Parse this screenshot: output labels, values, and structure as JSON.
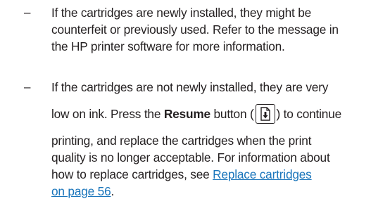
{
  "list": {
    "bullet_symbol": "–",
    "item1": {
      "line1": "If the cartridges are newly installed, they might be",
      "line2": "counterfeit or previously used. Refer to the message in",
      "line3": "the HP printer software for more information."
    },
    "item2": {
      "line1": "If the cartridges are not newly installed, they are very",
      "line2_before": "low on ink. Press the ",
      "line2_bold": "Resume",
      "line2_mid": " button (",
      "line2_after": ") to continue",
      "line3": "printing, and replace the cartridges when the print",
      "line4": "quality is no longer acceptable. For information about",
      "line5_before": "how to replace cartridges, see ",
      "link_line1": "Replace cartridges",
      "link_line2": "on page 56",
      "link_after": ".",
      "resume_icon": "resume-document-arrow-icon"
    }
  },
  "colors": {
    "text": "#231f20",
    "link": "#1a75bb"
  }
}
